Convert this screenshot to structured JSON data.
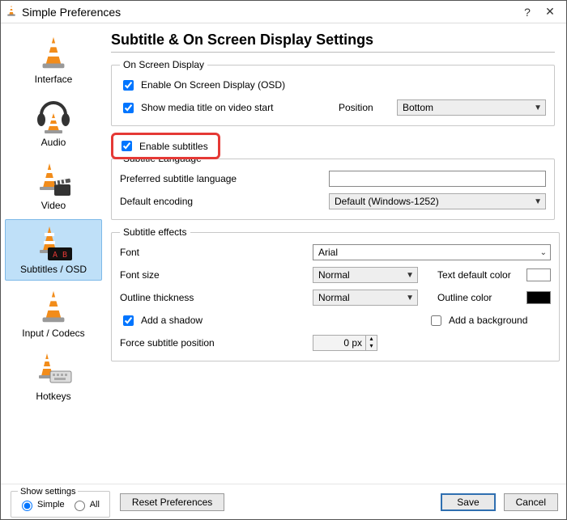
{
  "window": {
    "title": "Simple Preferences",
    "help_symbol": "?",
    "close_symbol": "✕"
  },
  "sidebar": {
    "items": [
      {
        "label": "Interface"
      },
      {
        "label": "Audio"
      },
      {
        "label": "Video"
      },
      {
        "label": "Subtitles / OSD"
      },
      {
        "label": "Input / Codecs"
      },
      {
        "label": "Hotkeys"
      }
    ]
  },
  "page": {
    "title": "Subtitle & On Screen Display Settings"
  },
  "osd": {
    "group_title": "On Screen Display",
    "enable_osd": "Enable On Screen Display (OSD)",
    "show_title": "Show media title on video start",
    "position_label": "Position",
    "position_value": "Bottom"
  },
  "enable_subs": {
    "label": "Enable subtitles"
  },
  "lang": {
    "group_title": "Subtitle Language",
    "preferred_label": "Preferred subtitle language",
    "preferred_value": "",
    "encoding_label": "Default encoding",
    "encoding_value": "Default (Windows-1252)"
  },
  "fx": {
    "group_title": "Subtitle effects",
    "font_label": "Font",
    "font_value": "Arial",
    "fontsize_label": "Font size",
    "fontsize_value": "Normal",
    "text_color_label": "Text default color",
    "text_color": "#ffffff",
    "outline_thickness_label": "Outline thickness",
    "outline_thickness_value": "Normal",
    "outline_color_label": "Outline color",
    "outline_color": "#000000",
    "add_shadow": "Add a shadow",
    "add_bg": "Add a background",
    "force_pos_label": "Force subtitle position",
    "force_pos_value": "0 px"
  },
  "footer": {
    "show_settings_title": "Show settings",
    "simple": "Simple",
    "all": "All",
    "reset": "Reset Preferences",
    "save": "Save",
    "cancel": "Cancel"
  }
}
